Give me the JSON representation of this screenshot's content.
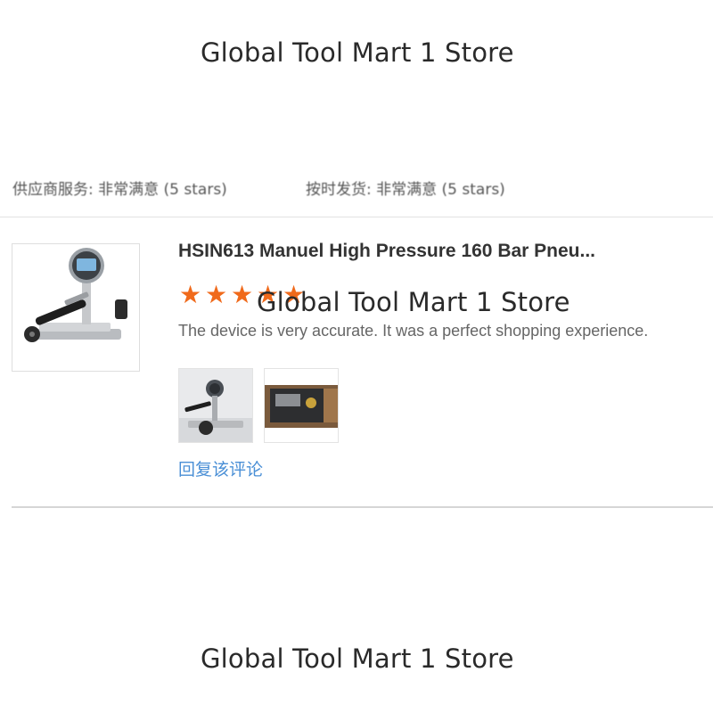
{
  "watermark": {
    "text": "Global Tool Mart 1 Store"
  },
  "previous_review": {
    "left_text": "供应商服务: 非常满意 (5 stars)",
    "right_text": "按时发货: 非常满意 (5 stars)"
  },
  "review": {
    "product_title": "HSIN613 Manuel High Pressure 160 Bar Pneu...",
    "rating": 5,
    "rating_max": 5,
    "star_glyph": "★",
    "star_color": "#f06a1b",
    "comment": "The device is very accurate. It was a perfect shopping experience.",
    "reply_label": "回复该评论",
    "link_color": "#4a8fd6",
    "photos": [
      {
        "icon": "pressure-pump-photo"
      },
      {
        "icon": "instrument-case-photo"
      }
    ]
  }
}
